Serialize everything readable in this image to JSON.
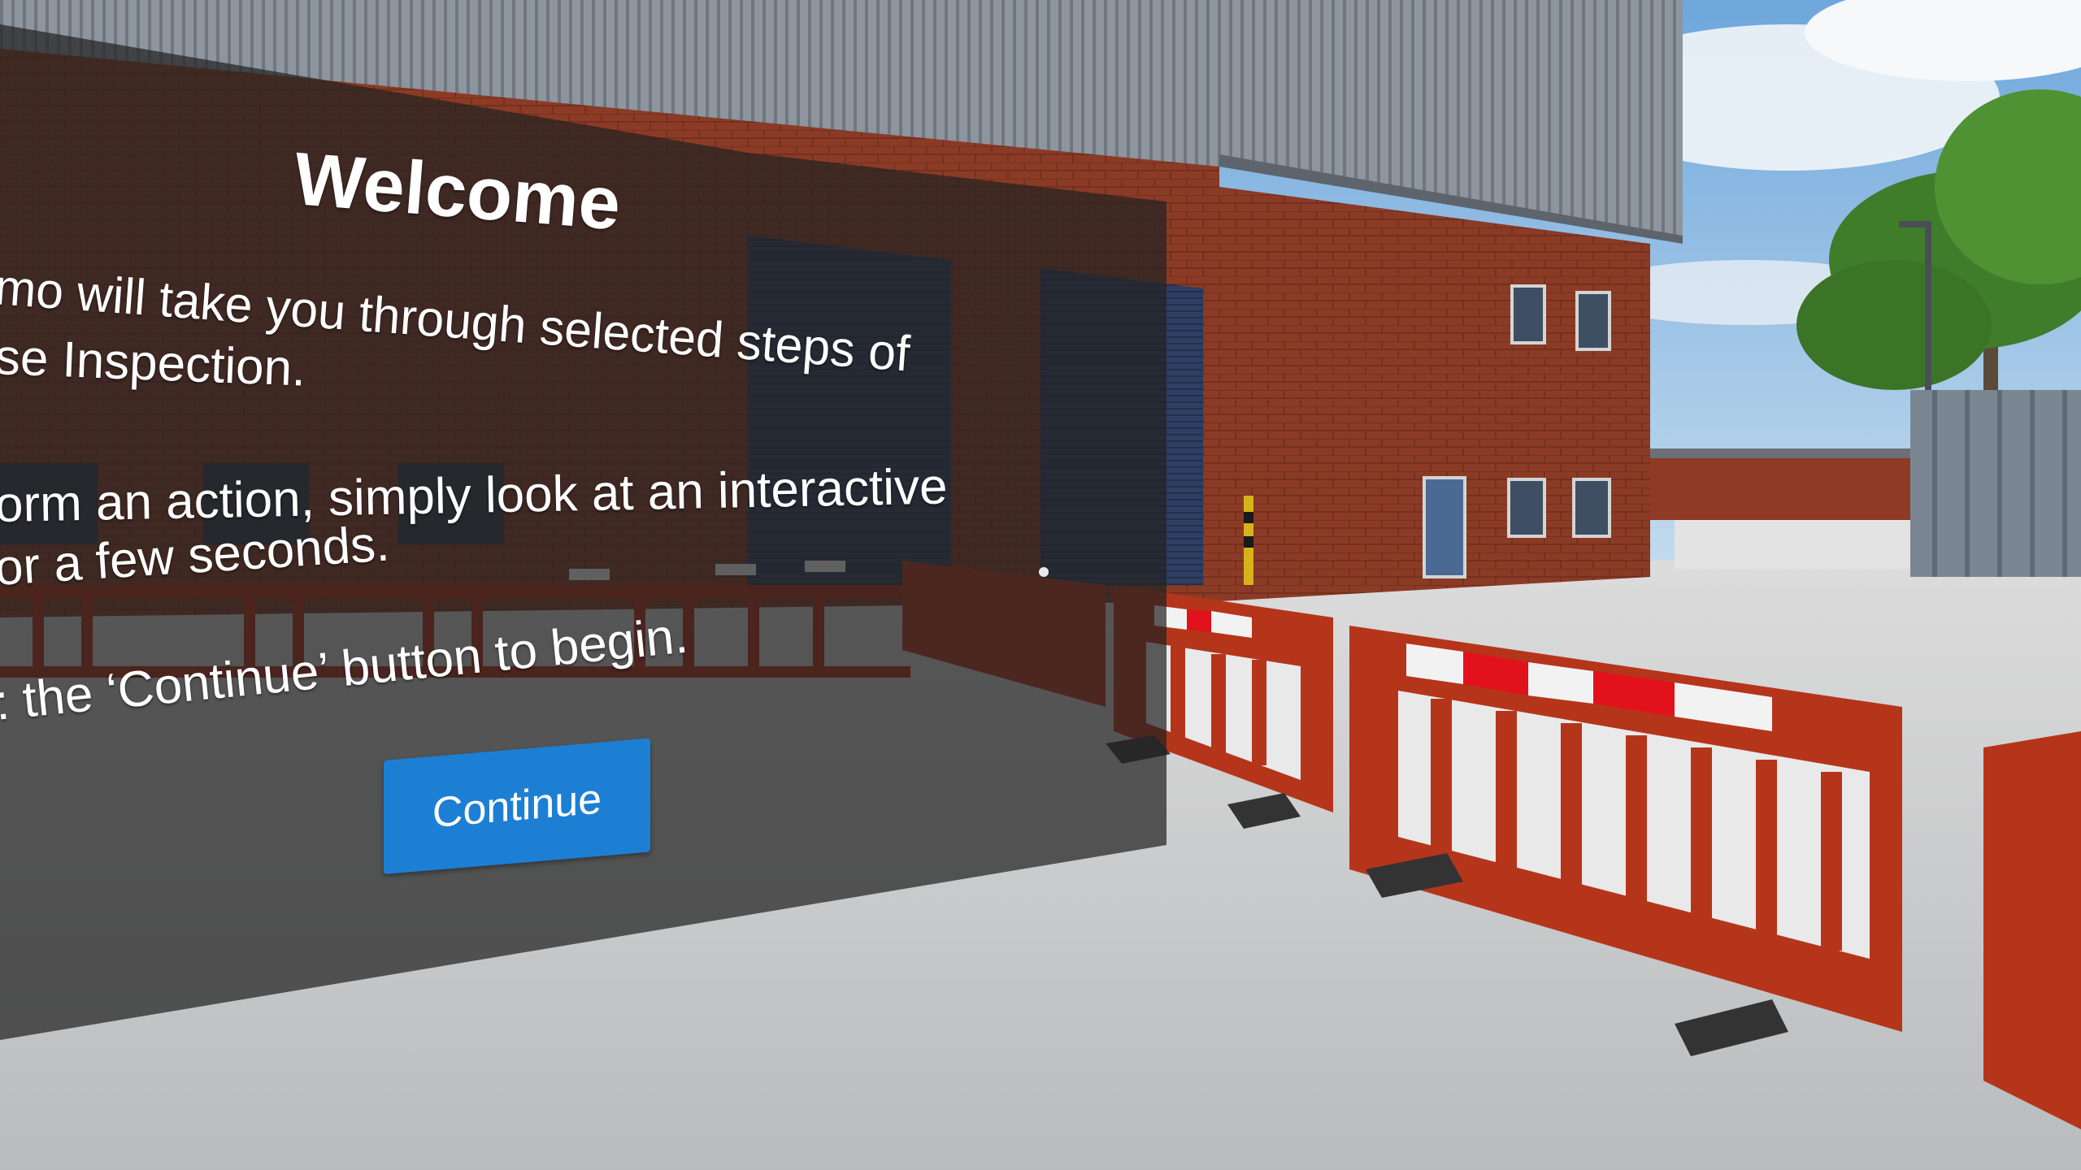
{
  "dialog": {
    "title": "Welcome",
    "lines": [
      "mo will take you through selected steps of",
      "se Inspection.",
      "orm an action, simply look at an interactive",
      "or a few seconds.",
      ": the ‘Continue’ button to begin."
    ],
    "continue_label": "Continue"
  },
  "colors": {
    "sky": "#8fbde6",
    "brick": "#8a3a26",
    "roof": "#8d959e",
    "ground": "#c9cbcd",
    "barrier": "#b52a14",
    "panel": "#2b2b2b",
    "button": "#1d7fd4"
  }
}
